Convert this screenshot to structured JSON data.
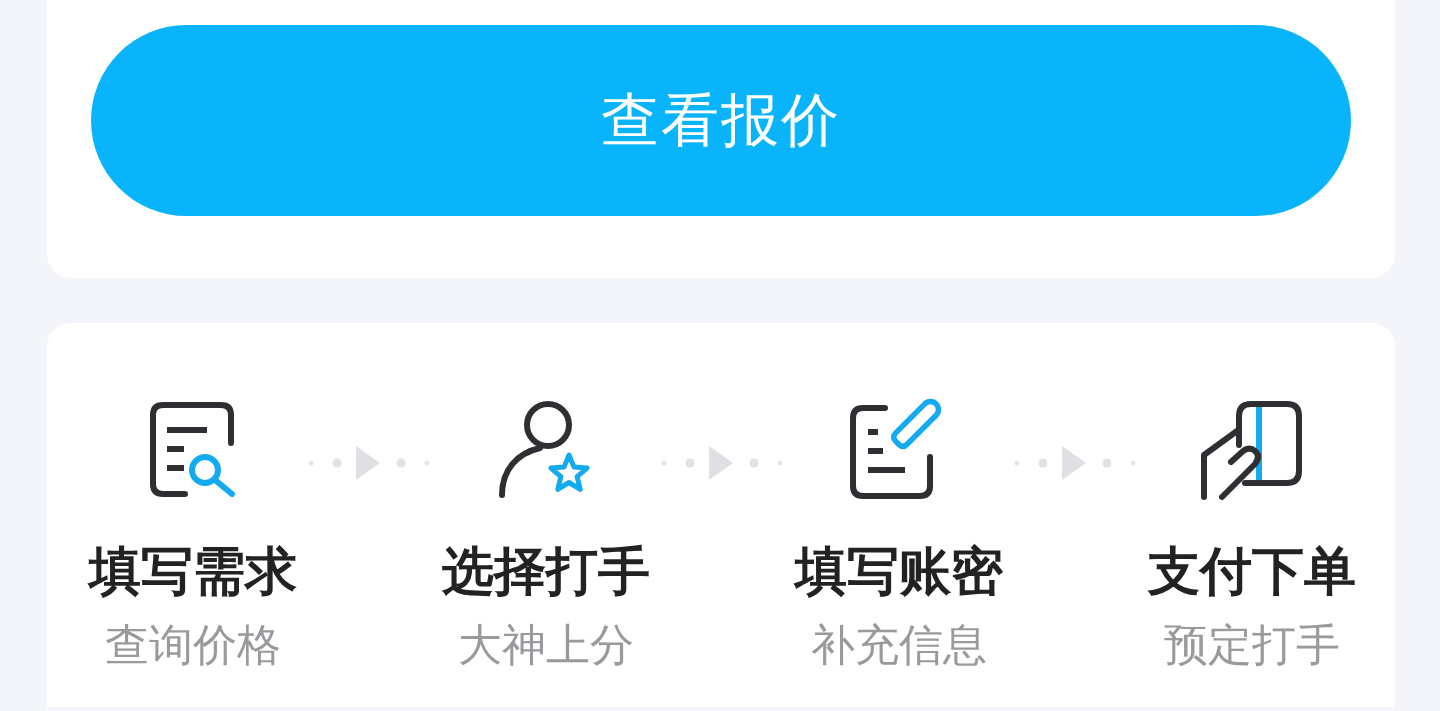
{
  "quote_button": {
    "label": "查看报价"
  },
  "steps": [
    {
      "kind": "document-search",
      "title": "填写需求",
      "subtitle": "查询价格"
    },
    {
      "kind": "user-star",
      "title": "选择打手",
      "subtitle": "大神上分"
    },
    {
      "kind": "document-pencil",
      "title": "填写账密",
      "subtitle": "补充信息"
    },
    {
      "kind": "hand-card",
      "title": "支付下单",
      "subtitle": "预定打手"
    }
  ]
}
